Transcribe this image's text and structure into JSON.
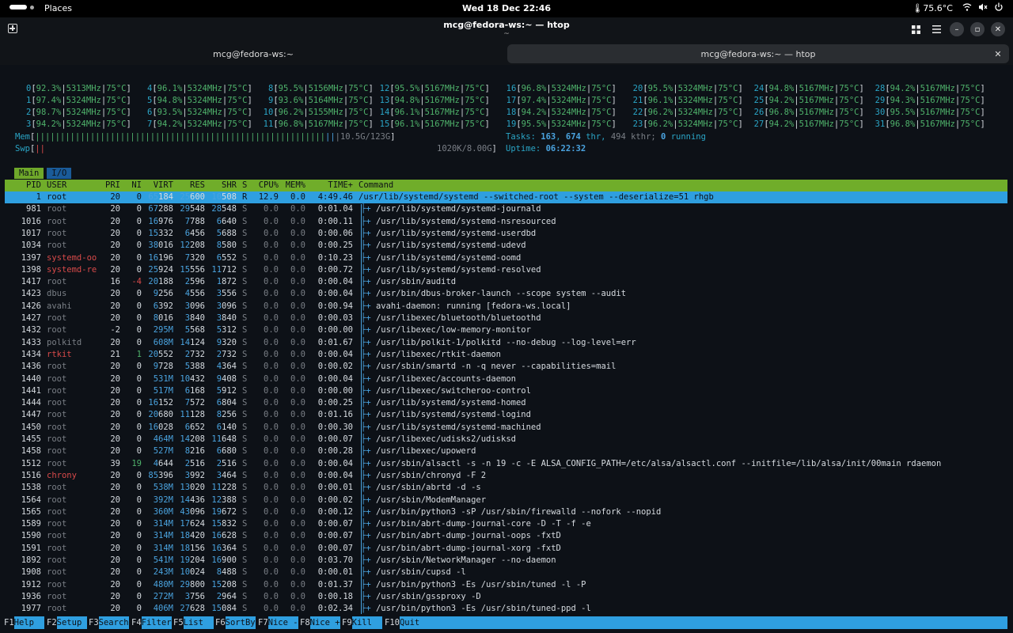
{
  "topbar": {
    "places": "Places",
    "clock": "Wed 18 Dec  22:46",
    "temperature": "75.6°C"
  },
  "header": {
    "title": "mcg@fedora-ws:~ — htop",
    "subtitle": "~"
  },
  "tabs": [
    {
      "label": "mcg@fedora-ws:~"
    },
    {
      "label": "mcg@fedora-ws:~ — htop"
    }
  ],
  "cpus": [
    {
      "id": "0",
      "pct": "92.3%",
      "mhz": "5313MHz",
      "temp": "75°C"
    },
    {
      "id": "1",
      "pct": "97.4%",
      "mhz": "5324MHz",
      "temp": "75°C"
    },
    {
      "id": "2",
      "pct": "98.7%",
      "mhz": "5324MHz",
      "temp": "75°C"
    },
    {
      "id": "3",
      "pct": "94.2%",
      "mhz": "5324MHz",
      "temp": "75°C"
    },
    {
      "id": "4",
      "pct": "96.1%",
      "mhz": "5324MHz",
      "temp": "75°C"
    },
    {
      "id": "5",
      "pct": "94.8%",
      "mhz": "5324MHz",
      "temp": "75°C"
    },
    {
      "id": "6",
      "pct": "93.5%",
      "mhz": "5324MHz",
      "temp": "75°C"
    },
    {
      "id": "7",
      "pct": "94.2%",
      "mhz": "5324MHz",
      "temp": "75°C"
    },
    {
      "id": "8",
      "pct": "95.5%",
      "mhz": "5156MHz",
      "temp": "75°C"
    },
    {
      "id": "9",
      "pct": "93.6%",
      "mhz": "5164MHz",
      "temp": "75°C"
    },
    {
      "id": "10",
      "pct": "96.2%",
      "mhz": "5155MHz",
      "temp": "75°C"
    },
    {
      "id": "11",
      "pct": "96.8%",
      "mhz": "5167MHz",
      "temp": "75°C"
    },
    {
      "id": "12",
      "pct": "95.5%",
      "mhz": "5167MHz",
      "temp": "75°C"
    },
    {
      "id": "13",
      "pct": "94.8%",
      "mhz": "5167MHz",
      "temp": "75°C"
    },
    {
      "id": "14",
      "pct": "96.1%",
      "mhz": "5167MHz",
      "temp": "75°C"
    },
    {
      "id": "15",
      "pct": "96.1%",
      "mhz": "5167MHz",
      "temp": "75°C"
    },
    {
      "id": "16",
      "pct": "96.8%",
      "mhz": "5324MHz",
      "temp": "75°C"
    },
    {
      "id": "17",
      "pct": "97.4%",
      "mhz": "5324MHz",
      "temp": "75°C"
    },
    {
      "id": "18",
      "pct": "94.2%",
      "mhz": "5324MHz",
      "temp": "75°C"
    },
    {
      "id": "19",
      "pct": "95.5%",
      "mhz": "5324MHz",
      "temp": "75°C"
    },
    {
      "id": "20",
      "pct": "95.5%",
      "mhz": "5324MHz",
      "temp": "75°C"
    },
    {
      "id": "21",
      "pct": "96.1%",
      "mhz": "5324MHz",
      "temp": "75°C"
    },
    {
      "id": "22",
      "pct": "96.2%",
      "mhz": "5324MHz",
      "temp": "75°C"
    },
    {
      "id": "23",
      "pct": "96.2%",
      "mhz": "5324MHz",
      "temp": "75°C"
    },
    {
      "id": "24",
      "pct": "94.8%",
      "mhz": "5167MHz",
      "temp": "75°C"
    },
    {
      "id": "25",
      "pct": "94.2%",
      "mhz": "5167MHz",
      "temp": "75°C"
    },
    {
      "id": "26",
      "pct": "96.8%",
      "mhz": "5167MHz",
      "temp": "75°C"
    },
    {
      "id": "27",
      "pct": "94.2%",
      "mhz": "5167MHz",
      "temp": "75°C"
    },
    {
      "id": "28",
      "pct": "94.2%",
      "mhz": "5167MHz",
      "temp": "75°C"
    },
    {
      "id": "29",
      "pct": "94.3%",
      "mhz": "5167MHz",
      "temp": "75°C"
    },
    {
      "id": "30",
      "pct": "95.5%",
      "mhz": "5167MHz",
      "temp": "75°C"
    },
    {
      "id": "31",
      "pct": "96.8%",
      "mhz": "5167MHz",
      "temp": "75°C"
    }
  ],
  "meters": {
    "mem_label": "Mem",
    "mem_value": "10.5G/123G",
    "swp_label": "Swp",
    "swp_value": "1020K/8.00G",
    "tasks_label": "Tasks:",
    "tasks": "163",
    "thr": "674",
    "thr_label": "thr,",
    "kthr": "494",
    "kthr_label": "kthr;",
    "running": "0",
    "running_label": "running",
    "uptime_label": "Uptime:",
    "uptime": "06:22:32"
  },
  "screen_tabs": [
    "Main",
    "I/O"
  ],
  "columns": [
    "PID",
    "USER",
    "PRI",
    "NI",
    "VIRT",
    "RES",
    "SHR",
    "S",
    "CPU%",
    "MEM%",
    "TIME+",
    "Command"
  ],
  "processes": [
    {
      "pid": "1",
      "user": "root",
      "pri": "20",
      "ni": "0",
      "virt": "65184",
      "res": "25600",
      "shr": "10508",
      "s": "R",
      "cpu": "12.9",
      "mem": "0.0",
      "time": "4:49.46",
      "cmd": "/usr/lib/systemd/systemd --switched-root --system --deserialize=51 rhgb",
      "selected": true
    },
    {
      "pid": "981",
      "user": "root",
      "pri": "20",
      "ni": "0",
      "virt": "67288",
      "res": "29548",
      "shr": "28548",
      "s": "S",
      "cpu": "0.0",
      "mem": "0.0",
      "time": "0:01.04",
      "cmd": "/usr/lib/systemd/systemd-journald"
    },
    {
      "pid": "1016",
      "user": "root",
      "pri": "20",
      "ni": "0",
      "virt": "16976",
      "res": "7788",
      "shr": "6640",
      "s": "S",
      "cpu": "0.0",
      "mem": "0.0",
      "time": "0:00.11",
      "cmd": "/usr/lib/systemd/systemd-nsresourced"
    },
    {
      "pid": "1017",
      "user": "root",
      "pri": "20",
      "ni": "0",
      "virt": "15332",
      "res": "6456",
      "shr": "5688",
      "s": "S",
      "cpu": "0.0",
      "mem": "0.0",
      "time": "0:00.06",
      "cmd": "/usr/lib/systemd/systemd-userdbd"
    },
    {
      "pid": "1034",
      "user": "root",
      "pri": "20",
      "ni": "0",
      "virt": "38016",
      "res": "12208",
      "shr": "8580",
      "s": "S",
      "cpu": "0.0",
      "mem": "0.0",
      "time": "0:00.25",
      "cmd": "/usr/lib/systemd/systemd-udevd"
    },
    {
      "pid": "1397",
      "user": "systemd-oo",
      "pri": "20",
      "ni": "0",
      "virt": "16196",
      "res": "7320",
      "shr": "6552",
      "s": "S",
      "cpu": "0.0",
      "mem": "0.0",
      "time": "0:10.23",
      "cmd": "/usr/lib/systemd/systemd-oomd",
      "user_color": "red"
    },
    {
      "pid": "1398",
      "user": "systemd-re",
      "pri": "20",
      "ni": "0",
      "virt": "25924",
      "res": "15556",
      "shr": "11712",
      "s": "S",
      "cpu": "0.0",
      "mem": "0.0",
      "time": "0:00.72",
      "cmd": "/usr/lib/systemd/systemd-resolved",
      "user_color": "red"
    },
    {
      "pid": "1417",
      "user": "root",
      "pri": "16",
      "ni": "-4",
      "virt": "20188",
      "res": "2596",
      "shr": "1872",
      "s": "S",
      "cpu": "0.0",
      "mem": "0.0",
      "time": "0:00.04",
      "cmd": "/usr/sbin/auditd",
      "ni_color": "red"
    },
    {
      "pid": "1423",
      "user": "dbus",
      "pri": "20",
      "ni": "0",
      "virt": "9256",
      "res": "4556",
      "shr": "3556",
      "s": "S",
      "cpu": "0.0",
      "mem": "0.0",
      "time": "0:00.04",
      "cmd": "/usr/bin/dbus-broker-launch --scope system --audit"
    },
    {
      "pid": "1426",
      "user": "avahi",
      "pri": "20",
      "ni": "0",
      "virt": "6392",
      "res": "3096",
      "shr": "3096",
      "s": "S",
      "cpu": "0.0",
      "mem": "0.0",
      "time": "0:00.94",
      "cmd": "avahi-daemon: running [fedora-ws.local]"
    },
    {
      "pid": "1427",
      "user": "root",
      "pri": "20",
      "ni": "0",
      "virt": "8016",
      "res": "3840",
      "shr": "3840",
      "s": "S",
      "cpu": "0.0",
      "mem": "0.0",
      "time": "0:00.03",
      "cmd": "/usr/libexec/bluetooth/bluetoothd"
    },
    {
      "pid": "1432",
      "user": "root",
      "pri": "-2",
      "ni": "0",
      "virt": "295M",
      "res": "5568",
      "shr": "5312",
      "s": "S",
      "cpu": "0.0",
      "mem": "0.0",
      "time": "0:00.00",
      "cmd": "/usr/libexec/low-memory-monitor"
    },
    {
      "pid": "1433",
      "user": "polkitd",
      "pri": "20",
      "ni": "0",
      "virt": "608M",
      "res": "14124",
      "shr": "9320",
      "s": "S",
      "cpu": "0.0",
      "mem": "0.0",
      "time": "0:01.67",
      "cmd": "/usr/lib/polkit-1/polkitd --no-debug --log-level=err"
    },
    {
      "pid": "1434",
      "user": "rtkit",
      "pri": "21",
      "ni": "1",
      "virt": "20552",
      "res": "2732",
      "shr": "2732",
      "s": "S",
      "cpu": "0.0",
      "mem": "0.0",
      "time": "0:00.04",
      "cmd": "/usr/libexec/rtkit-daemon",
      "user_color": "red",
      "ni_color": "green"
    },
    {
      "pid": "1436",
      "user": "root",
      "pri": "20",
      "ni": "0",
      "virt": "9728",
      "res": "5388",
      "shr": "4364",
      "s": "S",
      "cpu": "0.0",
      "mem": "0.0",
      "time": "0:00.02",
      "cmd": "/usr/sbin/smartd -n -q never --capabilities=mail"
    },
    {
      "pid": "1440",
      "user": "root",
      "pri": "20",
      "ni": "0",
      "virt": "531M",
      "res": "10432",
      "shr": "9408",
      "s": "S",
      "cpu": "0.0",
      "mem": "0.0",
      "time": "0:00.04",
      "cmd": "/usr/libexec/accounts-daemon"
    },
    {
      "pid": "1441",
      "user": "root",
      "pri": "20",
      "ni": "0",
      "virt": "517M",
      "res": "6168",
      "shr": "5912",
      "s": "S",
      "cpu": "0.0",
      "mem": "0.0",
      "time": "0:00.00",
      "cmd": "/usr/libexec/switcheroo-control"
    },
    {
      "pid": "1444",
      "user": "root",
      "pri": "20",
      "ni": "0",
      "virt": "16152",
      "res": "7572",
      "shr": "6804",
      "s": "S",
      "cpu": "0.0",
      "mem": "0.0",
      "time": "0:00.25",
      "cmd": "/usr/lib/systemd/systemd-homed"
    },
    {
      "pid": "1447",
      "user": "root",
      "pri": "20",
      "ni": "0",
      "virt": "20680",
      "res": "11128",
      "shr": "8256",
      "s": "S",
      "cpu": "0.0",
      "mem": "0.0",
      "time": "0:01.16",
      "cmd": "/usr/lib/systemd/systemd-logind"
    },
    {
      "pid": "1450",
      "user": "root",
      "pri": "20",
      "ni": "0",
      "virt": "16028",
      "res": "6652",
      "shr": "6140",
      "s": "S",
      "cpu": "0.0",
      "mem": "0.0",
      "time": "0:00.30",
      "cmd": "/usr/lib/systemd/systemd-machined"
    },
    {
      "pid": "1455",
      "user": "root",
      "pri": "20",
      "ni": "0",
      "virt": "464M",
      "res": "14208",
      "shr": "11648",
      "s": "S",
      "cpu": "0.0",
      "mem": "0.0",
      "time": "0:00.07",
      "cmd": "/usr/libexec/udisks2/udisksd"
    },
    {
      "pid": "1458",
      "user": "root",
      "pri": "20",
      "ni": "0",
      "virt": "527M",
      "res": "8216",
      "shr": "6680",
      "s": "S",
      "cpu": "0.0",
      "mem": "0.0",
      "time": "0:00.28",
      "cmd": "/usr/libexec/upowerd"
    },
    {
      "pid": "1512",
      "user": "root",
      "pri": "39",
      "ni": "19",
      "virt": "4644",
      "res": "2516",
      "shr": "2516",
      "s": "S",
      "cpu": "0.0",
      "mem": "0.0",
      "time": "0:00.04",
      "cmd": "/usr/sbin/alsactl -s -n 19 -c -E ALSA_CONFIG_PATH=/etc/alsa/alsactl.conf --initfile=/lib/alsa/init/00main rdaemon",
      "ni_color": "green"
    },
    {
      "pid": "1516",
      "user": "chrony",
      "pri": "20",
      "ni": "0",
      "virt": "85396",
      "res": "3992",
      "shr": "3464",
      "s": "S",
      "cpu": "0.0",
      "mem": "0.0",
      "time": "0:00.04",
      "cmd": "/usr/sbin/chronyd -F 2",
      "user_color": "red"
    },
    {
      "pid": "1538",
      "user": "root",
      "pri": "20",
      "ni": "0",
      "virt": "538M",
      "res": "13020",
      "shr": "11228",
      "s": "S",
      "cpu": "0.0",
      "mem": "0.0",
      "time": "0:00.01",
      "cmd": "/usr/sbin/abrtd -d -s"
    },
    {
      "pid": "1564",
      "user": "root",
      "pri": "20",
      "ni": "0",
      "virt": "392M",
      "res": "14436",
      "shr": "12388",
      "s": "S",
      "cpu": "0.0",
      "mem": "0.0",
      "time": "0:00.02",
      "cmd": "/usr/sbin/ModemManager"
    },
    {
      "pid": "1565",
      "user": "root",
      "pri": "20",
      "ni": "0",
      "virt": "360M",
      "res": "43096",
      "shr": "19672",
      "s": "S",
      "cpu": "0.0",
      "mem": "0.0",
      "time": "0:00.12",
      "cmd": "/usr/bin/python3 -sP /usr/sbin/firewalld --nofork --nopid"
    },
    {
      "pid": "1589",
      "user": "root",
      "pri": "20",
      "ni": "0",
      "virt": "314M",
      "res": "17624",
      "shr": "15832",
      "s": "S",
      "cpu": "0.0",
      "mem": "0.0",
      "time": "0:00.07",
      "cmd": "/usr/bin/abrt-dump-journal-core -D -T -f -e"
    },
    {
      "pid": "1590",
      "user": "root",
      "pri": "20",
      "ni": "0",
      "virt": "314M",
      "res": "18420",
      "shr": "16628",
      "s": "S",
      "cpu": "0.0",
      "mem": "0.0",
      "time": "0:00.07",
      "cmd": "/usr/bin/abrt-dump-journal-oops -fxtD"
    },
    {
      "pid": "1591",
      "user": "root",
      "pri": "20",
      "ni": "0",
      "virt": "314M",
      "res": "18156",
      "shr": "16364",
      "s": "S",
      "cpu": "0.0",
      "mem": "0.0",
      "time": "0:00.07",
      "cmd": "/usr/bin/abrt-dump-journal-xorg -fxtD"
    },
    {
      "pid": "1892",
      "user": "root",
      "pri": "20",
      "ni": "0",
      "virt": "541M",
      "res": "19204",
      "shr": "16900",
      "s": "S",
      "cpu": "0.0",
      "mem": "0.0",
      "time": "0:03.70",
      "cmd": "/usr/sbin/NetworkManager --no-daemon"
    },
    {
      "pid": "1908",
      "user": "root",
      "pri": "20",
      "ni": "0",
      "virt": "243M",
      "res": "10024",
      "shr": "8488",
      "s": "S",
      "cpu": "0.0",
      "mem": "0.0",
      "time": "0:00.01",
      "cmd": "/usr/sbin/cupsd -l"
    },
    {
      "pid": "1912",
      "user": "root",
      "pri": "20",
      "ni": "0",
      "virt": "480M",
      "res": "29800",
      "shr": "15208",
      "s": "S",
      "cpu": "0.0",
      "mem": "0.0",
      "time": "0:01.37",
      "cmd": "/usr/bin/python3 -Es /usr/sbin/tuned -l -P"
    },
    {
      "pid": "1936",
      "user": "root",
      "pri": "20",
      "ni": "0",
      "virt": "272M",
      "res": "3756",
      "shr": "2964",
      "s": "S",
      "cpu": "0.0",
      "mem": "0.0",
      "time": "0:00.18",
      "cmd": "/usr/sbin/gssproxy -D"
    },
    {
      "pid": "1977",
      "user": "root",
      "pri": "20",
      "ni": "0",
      "virt": "406M",
      "res": "27628",
      "shr": "15084",
      "s": "S",
      "cpu": "0.0",
      "mem": "0.0",
      "time": "0:02.34",
      "cmd": "/usr/bin/python3 -Es /usr/sbin/tuned-ppd -l"
    }
  ],
  "fkeys": [
    {
      "key": "F1",
      "label": "Help  "
    },
    {
      "key": "F2",
      "label": "Setup "
    },
    {
      "key": "F3",
      "label": "Search"
    },
    {
      "key": "F4",
      "label": "Filter"
    },
    {
      "key": "F5",
      "label": "List  "
    },
    {
      "key": "F6",
      "label": "SortBy"
    },
    {
      "key": "F7",
      "label": "Nice -"
    },
    {
      "key": "F8",
      "label": "Nice +"
    },
    {
      "key": "F9",
      "label": "Kill  "
    },
    {
      "key": "F10",
      "label": "Quit  "
    }
  ],
  "colors": {
    "header_green": "#70ad2a",
    "selection_blue": "#2f9fe0",
    "accent_cyan": "#2aa5c6"
  }
}
